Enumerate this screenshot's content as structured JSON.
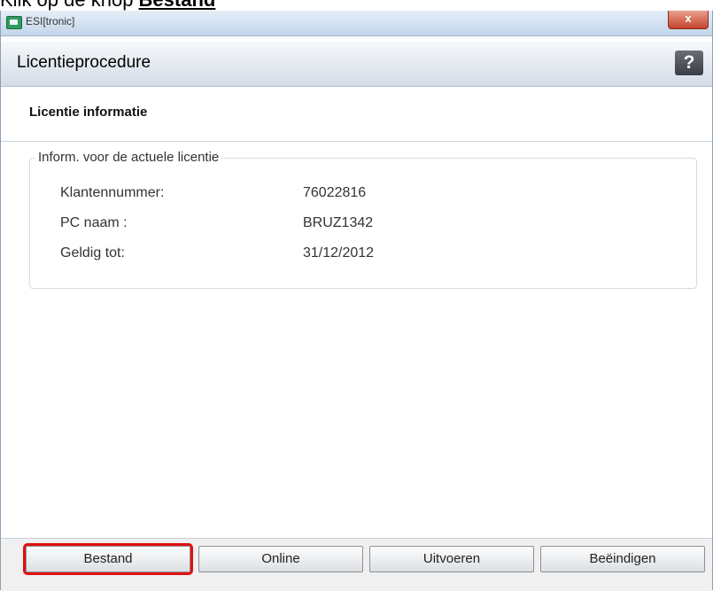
{
  "instruction": {
    "prefix": "Klik op de knop ",
    "keyword": "Bestand"
  },
  "window": {
    "title": "ESI[tronic]",
    "close_label": "x"
  },
  "header": {
    "title": "Licentieprocedure",
    "help_label": "?"
  },
  "subheader": {
    "title": "Licentie informatie"
  },
  "license_group": {
    "legend": "Inform. voor de actuele licentie",
    "rows": [
      {
        "label": "Klantennummer:",
        "value": "76022816"
      },
      {
        "label": "PC naam :",
        "value": "BRUZ1342"
      },
      {
        "label": "Geldig tot:",
        "value": "31/12/2012"
      }
    ]
  },
  "footer": {
    "buttons": [
      "Bestand",
      "Online",
      "Uitvoeren",
      "Beëindigen"
    ]
  },
  "colors": {
    "highlight": "#e01010",
    "titlebar": "#c4d6ea",
    "close": "#c4442e"
  }
}
